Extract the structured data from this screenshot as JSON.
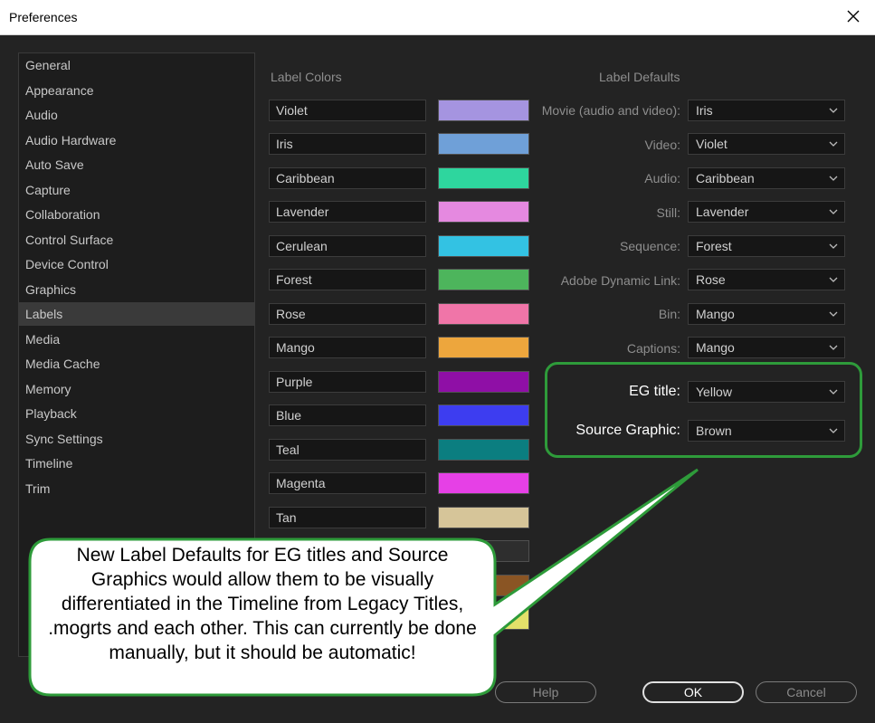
{
  "window": {
    "title": "Preferences"
  },
  "sidebar": {
    "items": [
      "General",
      "Appearance",
      "Audio",
      "Audio Hardware",
      "Auto Save",
      "Capture",
      "Collaboration",
      "Control Surface",
      "Device Control",
      "Graphics",
      "Labels",
      "Media",
      "Media Cache",
      "Memory",
      "Playback",
      "Sync Settings",
      "Timeline",
      "Trim"
    ],
    "selected": "Labels"
  },
  "label_colors": {
    "heading": "Label Colors",
    "items": [
      {
        "name": "Violet",
        "color": "#a594e0"
      },
      {
        "name": "Iris",
        "color": "#6fa0d8"
      },
      {
        "name": "Caribbean",
        "color": "#2ed69e"
      },
      {
        "name": "Lavender",
        "color": "#e589e0"
      },
      {
        "name": "Cerulean",
        "color": "#33c2e3"
      },
      {
        "name": "Forest",
        "color": "#4db55c"
      },
      {
        "name": "Rose",
        "color": "#f075a8"
      },
      {
        "name": "Mango",
        "color": "#eda63d"
      },
      {
        "name": "Purple",
        "color": "#8f0fa6"
      },
      {
        "name": "Blue",
        "color": "#3d3df0"
      },
      {
        "name": "Teal",
        "color": "#0b7e80"
      },
      {
        "name": "Magenta",
        "color": "#e640e6"
      },
      {
        "name": "Tan",
        "color": "#d6c599"
      }
    ],
    "partial_swatches": [
      "#2e2e2e",
      "#8a5524",
      "#e3e06a"
    ]
  },
  "label_defaults": {
    "heading": "Label Defaults",
    "items": [
      {
        "label": "Movie (audio and video):",
        "value": "Iris"
      },
      {
        "label": "Video:",
        "value": "Violet"
      },
      {
        "label": "Audio:",
        "value": "Caribbean"
      },
      {
        "label": "Still:",
        "value": "Lavender"
      },
      {
        "label": "Sequence:",
        "value": "Forest"
      },
      {
        "label": "Adobe Dynamic Link:",
        "value": "Rose"
      },
      {
        "label": "Bin:",
        "value": "Mango"
      },
      {
        "label": "Captions:",
        "value": "Mango"
      }
    ],
    "highlighted": [
      {
        "label": "EG title:",
        "value": "Yellow"
      },
      {
        "label": "Source Graphic:",
        "value": "Brown"
      }
    ]
  },
  "buttons": {
    "help": "Help",
    "ok": "OK",
    "cancel": "Cancel"
  },
  "callout": {
    "text": "New Label Defaults for EG titles and Source Graphics would allow them to be visually differentiated in the Timeline from Legacy Titles, .mogrts and each other.  This can currently be done manually, but it should be automatic!",
    "border_color": "#2e9b3a"
  }
}
